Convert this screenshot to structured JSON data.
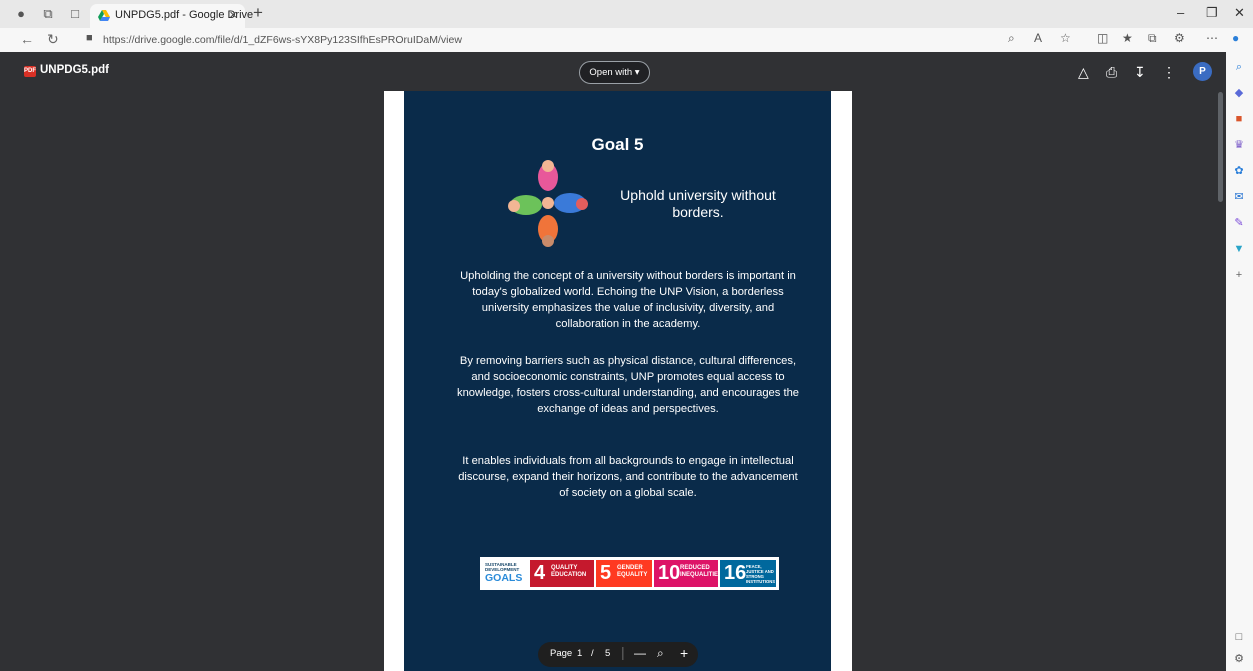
{
  "browser": {
    "tab_title": "UNPDG5.pdf - Google Drive",
    "url": "https://drive.google.com/file/d/1_dZF6ws-sYX8Py123SIfhEsPROruIDaM/view"
  },
  "viewer": {
    "file_name": "UNPDG5.pdf",
    "file_icon_text": "PDF",
    "open_with": "Open with",
    "avatar_letter": "P",
    "page_label": "Page",
    "page_current": "1",
    "page_sep": "/",
    "page_total": "5"
  },
  "document": {
    "goal_title": "Goal 5",
    "subtitle": "Uphold university without borders.",
    "paragraph1": "Upholding the concept of a university without borders is important in today's globalized world. Echoing the UNP Vision, a borderless university emphasizes the value of inclusivity, diversity, and collaboration in the academy.",
    "paragraph2": "By removing barriers such as physical distance, cultural differences, and socioeconomic constraints, UNP promotes equal access to knowledge, fosters cross-cultural understanding, and encourages the exchange of ideas and perspectives.",
    "paragraph3": "It enables individuals from all backgrounds to engage in intellectual discourse, expand their horizons, and contribute to the advancement of society on a global scale.",
    "sdg_brand_line1": "SUSTAINABLE DEVELOPMENT",
    "sdg_brand_line2": "GOALS",
    "sdg_goals": [
      {
        "number": "4",
        "label": "QUALITY EDUCATION",
        "color": "#c5192d"
      },
      {
        "number": "5",
        "label": "GENDER EQUALITY",
        "color": "#ff3a21"
      },
      {
        "number": "10",
        "label": "REDUCED INEQUALITIES",
        "color": "#dd1367"
      },
      {
        "number": "16",
        "label": "PEACE, JUSTICE AND STRONG INSTITUTIONS",
        "color": "#00689d"
      }
    ]
  },
  "colors": {
    "page_background": "#0a2b4a",
    "viewer_background": "#303134"
  },
  "icons": [
    "profile-icon",
    "collections-icon",
    "tab-actions-icon",
    "drive-icon",
    "back-icon",
    "refresh-icon",
    "lock-icon",
    "zoom-icon",
    "read-aloud-icon",
    "favorite-icon",
    "split-screen-icon",
    "favorites-list-icon",
    "collections-bar-icon",
    "extensions-icon",
    "more-icon",
    "copilot-icon",
    "add-to-drive-icon",
    "print-icon",
    "download-icon",
    "kebab-menu-icon",
    "zoom-out-icon",
    "zoom-in-icon"
  ]
}
